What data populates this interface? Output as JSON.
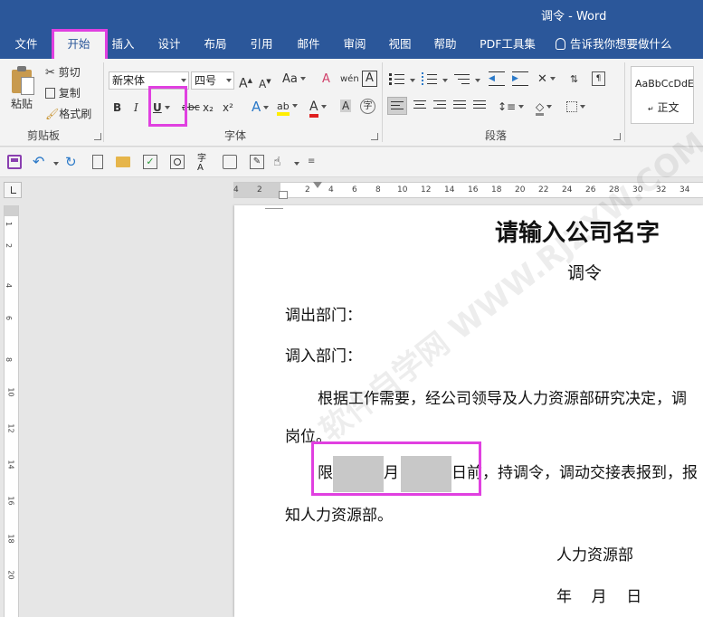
{
  "window": {
    "title": "调令  -  Word"
  },
  "tabs": [
    "文件",
    "开始",
    "插入",
    "设计",
    "布局",
    "引用",
    "邮件",
    "审阅",
    "视图",
    "帮助",
    "PDF工具集"
  ],
  "tell_me": "告诉我你想要做什么",
  "clipboard": {
    "paste": "粘贴",
    "cut": "剪切",
    "copy": "复制",
    "format_painter": "格式刷",
    "label": "剪贴板"
  },
  "font": {
    "name": "新宋体",
    "size": "四号",
    "label": "字体",
    "bold": "B",
    "italic": "I",
    "underline": "U",
    "strike": "abc",
    "sub": "x₂",
    "sup": "x²",
    "grow": "A",
    "shrink": "A",
    "case": "Aa",
    "clear": "A",
    "phonetic": "wén",
    "border": "A",
    "effect": "A",
    "highlight": "ab",
    "color": "A",
    "enclose": "字"
  },
  "paragraph": {
    "label": "段落"
  },
  "styles": {
    "preview": "AaBbCcDdE",
    "normal": "正文"
  },
  "ruler": {
    "h": [
      "4",
      "2",
      "2",
      "4",
      "6",
      "8",
      "10",
      "12",
      "14",
      "16",
      "18",
      "20",
      "22",
      "24",
      "26",
      "28",
      "30",
      "32",
      "34"
    ],
    "v": [
      "1",
      "2",
      "4",
      "6",
      "8",
      "10",
      "12",
      "14",
      "16",
      "18",
      "20"
    ]
  },
  "document": {
    "company": "请输入公司名字",
    "title": "调令",
    "out_dept": "调出部门：",
    "in_dept": "调入部门：",
    "para1": "根据工作需要，经公司领导及人力资源部研究决定，调",
    "para1_end": "岗位。",
    "limit": "限",
    "month": "月",
    "before_day": "日前",
    "para2_rest": "，持调令，调动交接表报到，报",
    "para2_end": "知人力资源部。",
    "signer": "人力资源部",
    "date": "年    月    日"
  },
  "watermark": "软件自学网 WWW.RJZXW.COM",
  "colors": {
    "brand": "#2b579a",
    "highlight": "#e040e0"
  }
}
